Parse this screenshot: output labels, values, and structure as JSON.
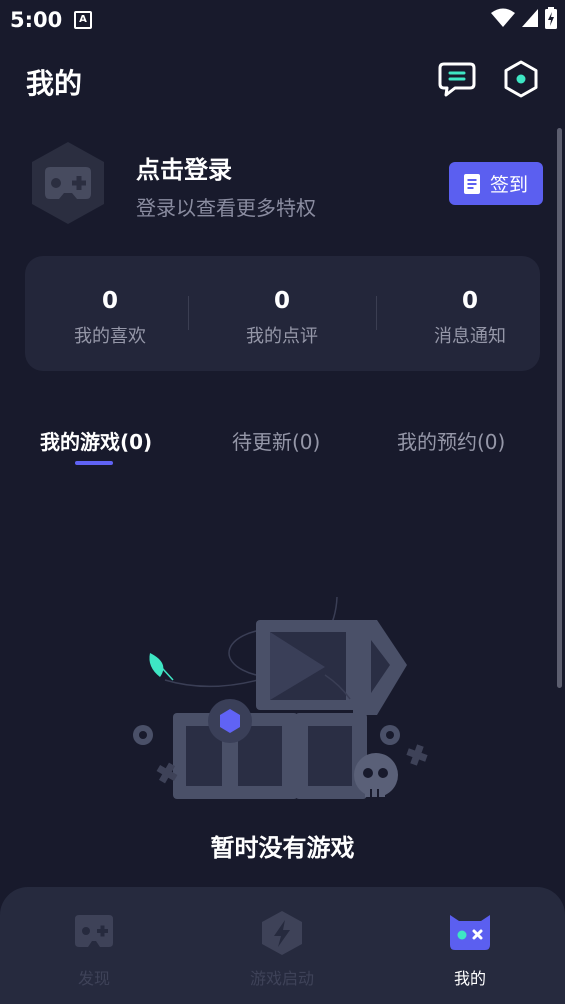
{
  "status_bar": {
    "time": "5:00",
    "notification_icon": "A"
  },
  "header": {
    "title": "我的",
    "icons": [
      "chat-icon",
      "settings-hexagon-icon"
    ]
  },
  "profile": {
    "title": "点击登录",
    "subtitle": "登录以查看更多特权",
    "signin_label": "签到"
  },
  "stats": [
    {
      "value": "0",
      "label": "我的喜欢"
    },
    {
      "value": "0",
      "label": "我的点评"
    },
    {
      "value": "0",
      "label": "消息通知"
    }
  ],
  "tabs": [
    {
      "label": "我的游戏(0)",
      "active": true
    },
    {
      "label": "待更新(0)",
      "active": false
    },
    {
      "label": "我的预约(0)",
      "active": false
    }
  ],
  "empty_state": {
    "text": "暂时没有游戏"
  },
  "bottom_nav": [
    {
      "label": "发现",
      "icon": "gamepad-icon",
      "active": false
    },
    {
      "label": "游戏启动",
      "icon": "lightning-hexagon-icon",
      "active": false
    },
    {
      "label": "我的",
      "icon": "my-profile-icon",
      "active": true
    }
  ],
  "colors": {
    "background": "#181a2c",
    "accent": "#5b5ff0",
    "card": "#23263a",
    "teal": "#3ee6c4"
  }
}
